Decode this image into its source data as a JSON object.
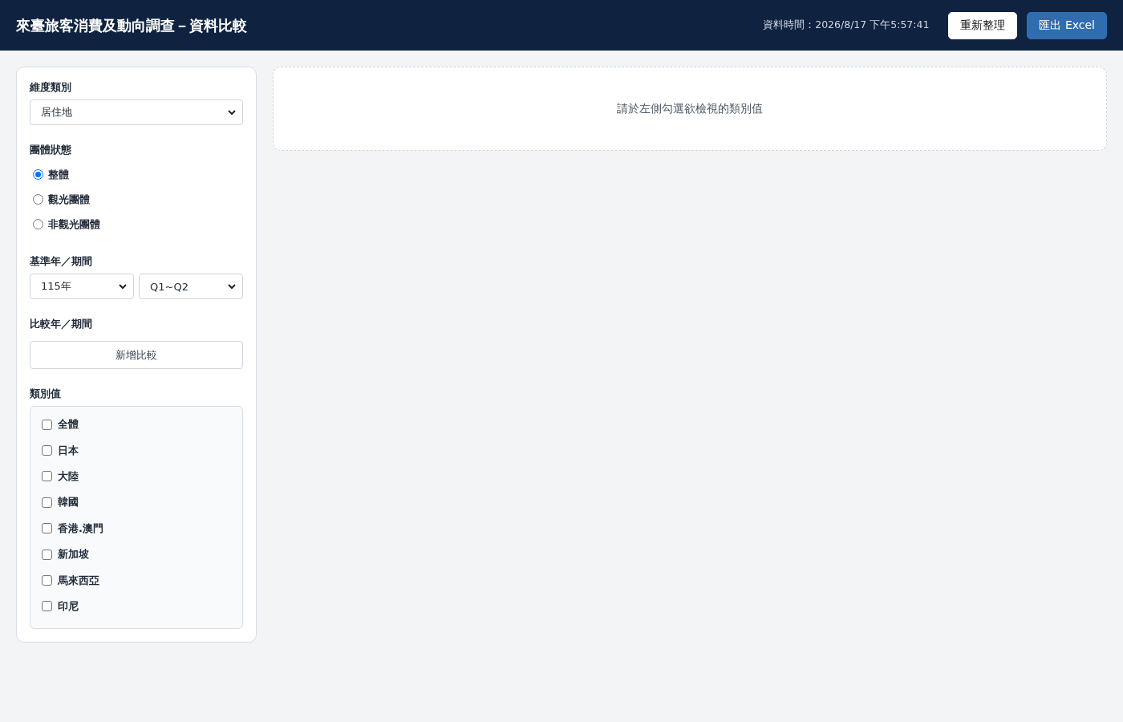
{
  "header": {
    "title": "來臺旅客消費及動向調查－資料比較",
    "timestamp": "資料時間：2026/8/17 下午5:57:41",
    "buttons": [
      {
        "label": "重新整理",
        "kind": "secondary"
      },
      {
        "label": "匯出 Excel",
        "kind": "primary"
      }
    ]
  },
  "sidebar": {
    "dimension": {
      "label": "維度類別",
      "value": "居住地"
    },
    "group_status": {
      "label": "團體狀態",
      "options": [
        {
          "label": "整體",
          "selected": true
        },
        {
          "label": "觀光團體",
          "selected": false
        },
        {
          "label": "非觀光團體",
          "selected": false
        }
      ]
    },
    "base_period": {
      "label": "基準年／期間",
      "year": "115年",
      "period": "Q1~Q2"
    },
    "compare_period": {
      "label": "比較年／期間",
      "button": "新增比較"
    },
    "category_values": {
      "label": "類別值",
      "items": [
        {
          "label": "全體",
          "checked": false
        },
        {
          "label": "日本",
          "checked": false
        },
        {
          "label": "大陸",
          "checked": false
        },
        {
          "label": "韓國",
          "checked": false
        },
        {
          "label": "香港.澳門",
          "checked": false
        },
        {
          "label": "新加坡",
          "checked": false
        },
        {
          "label": "馬來西亞",
          "checked": false
        },
        {
          "label": "印尼",
          "checked": false
        }
      ]
    }
  },
  "main": {
    "empty_message": "請於左側勾選欲檢視的類別值"
  }
}
